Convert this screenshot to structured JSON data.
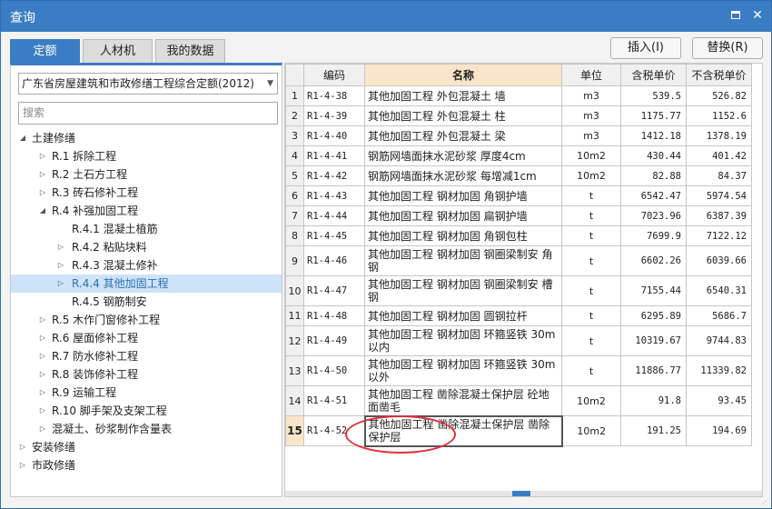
{
  "window": {
    "title": "查询"
  },
  "tabs": [
    {
      "label": "定额",
      "active": true
    },
    {
      "label": "人材机",
      "active": false
    },
    {
      "label": "我的数据",
      "active": false
    }
  ],
  "buttons": {
    "insert": "插入(I)",
    "replace": "替换(R)"
  },
  "left": {
    "quota_select": "广东省房屋建筑和市政修缮工程综合定额(2012)",
    "search_placeholder": "搜索",
    "tree": [
      {
        "label": "土建修缮",
        "level": 0,
        "state": "expanded"
      },
      {
        "label": "R.1 拆除工程",
        "level": 1,
        "state": "collapsed"
      },
      {
        "label": "R.2 土石方工程",
        "level": 1,
        "state": "collapsed"
      },
      {
        "label": "R.3 砖石修补工程",
        "level": 1,
        "state": "collapsed"
      },
      {
        "label": "R.4 补强加固工程",
        "level": 1,
        "state": "expanded"
      },
      {
        "label": "R.4.1 混凝土植筋",
        "level": 2,
        "state": "leaf"
      },
      {
        "label": "R.4.2 粘贴块料",
        "level": 2,
        "state": "collapsed"
      },
      {
        "label": "R.4.3 混凝土修补",
        "level": 2,
        "state": "collapsed"
      },
      {
        "label": "R.4.4 其他加固工程",
        "level": 2,
        "state": "collapsed",
        "selected": true
      },
      {
        "label": "R.4.5 钢筋制安",
        "level": 2,
        "state": "leaf"
      },
      {
        "label": "R.5 木作门窗修补工程",
        "level": 1,
        "state": "collapsed"
      },
      {
        "label": "R.6 屋面修补工程",
        "level": 1,
        "state": "collapsed"
      },
      {
        "label": "R.7 防水修补工程",
        "level": 1,
        "state": "collapsed"
      },
      {
        "label": "R.8 装饰修补工程",
        "level": 1,
        "state": "collapsed"
      },
      {
        "label": "R.9 运输工程",
        "level": 1,
        "state": "collapsed"
      },
      {
        "label": "R.10 脚手架及支架工程",
        "level": 1,
        "state": "collapsed"
      },
      {
        "label": "混凝土、砂浆制作含量表",
        "level": 1,
        "state": "collapsed"
      },
      {
        "label": "安装修缮",
        "level": 0,
        "state": "collapsed"
      },
      {
        "label": "市政修缮",
        "level": 0,
        "state": "collapsed"
      }
    ]
  },
  "table": {
    "columns": [
      "编码",
      "名称",
      "单位",
      "含税单价",
      "不含税单价"
    ],
    "rows": [
      {
        "n": "1",
        "code": "R1-4-38",
        "name": "其他加固工程 外包混凝土 墙",
        "unit": "m3",
        "tax": "539.5",
        "notax": "526.82"
      },
      {
        "n": "2",
        "code": "R1-4-39",
        "name": "其他加固工程 外包混凝土 柱",
        "unit": "m3",
        "tax": "1175.77",
        "notax": "1152.6"
      },
      {
        "n": "3",
        "code": "R1-4-40",
        "name": "其他加固工程 外包混凝土 梁",
        "unit": "m3",
        "tax": "1412.18",
        "notax": "1378.19"
      },
      {
        "n": "4",
        "code": "R1-4-41",
        "name": "钢筋网墙面抹水泥砂浆 厚度4cm",
        "unit": "10m2",
        "tax": "430.44",
        "notax": "401.42"
      },
      {
        "n": "5",
        "code": "R1-4-42",
        "name": "钢筋网墙面抹水泥砂浆 每增减1cm",
        "unit": "10m2",
        "tax": "82.88",
        "notax": "84.37"
      },
      {
        "n": "6",
        "code": "R1-4-43",
        "name": "其他加固工程 钢材加固 角钢护墙",
        "unit": "t",
        "tax": "6542.47",
        "notax": "5974.54"
      },
      {
        "n": "7",
        "code": "R1-4-44",
        "name": "其他加固工程 钢材加固 扁钢护墙",
        "unit": "t",
        "tax": "7023.96",
        "notax": "6387.39"
      },
      {
        "n": "8",
        "code": "R1-4-45",
        "name": "其他加固工程 钢材加固 角钢包柱",
        "unit": "t",
        "tax": "7699.9",
        "notax": "7122.12"
      },
      {
        "n": "9",
        "code": "R1-4-46",
        "name": "其他加固工程 钢材加固 钢圈梁制安 角钢",
        "unit": "t",
        "tax": "6602.26",
        "notax": "6039.66"
      },
      {
        "n": "10",
        "code": "R1-4-47",
        "name": "其他加固工程 钢材加固 钢圈梁制安 槽钢",
        "unit": "t",
        "tax": "7155.44",
        "notax": "6540.31"
      },
      {
        "n": "11",
        "code": "R1-4-48",
        "name": "其他加固工程 钢材加固 圆钢拉杆",
        "unit": "t",
        "tax": "6295.89",
        "notax": "5686.7"
      },
      {
        "n": "12",
        "code": "R1-4-49",
        "name": "其他加固工程 钢材加固 环箍竖铁 30m以内",
        "unit": "t",
        "tax": "10319.67",
        "notax": "9744.83"
      },
      {
        "n": "13",
        "code": "R1-4-50",
        "name": "其他加固工程 钢材加固 环箍竖铁 30m以外",
        "unit": "t",
        "tax": "11886.77",
        "notax": "11339.82"
      },
      {
        "n": "14",
        "code": "R1-4-51",
        "name": "其他加固工程 凿除混凝土保护层 砼地面凿毛",
        "unit": "10m2",
        "tax": "91.8",
        "notax": "93.45"
      },
      {
        "n": "15",
        "code": "R1-4-52",
        "name": "其他加固工程 凿除混凝土保护层 凿除保护层",
        "unit": "10m2",
        "tax": "191.25",
        "notax": "194.69",
        "active": true
      }
    ]
  },
  "colors": {
    "accent": "#3b7dc4",
    "highlight": "#fbe5c8",
    "selection": "#cde3f7",
    "annotation": "#e0303a"
  }
}
